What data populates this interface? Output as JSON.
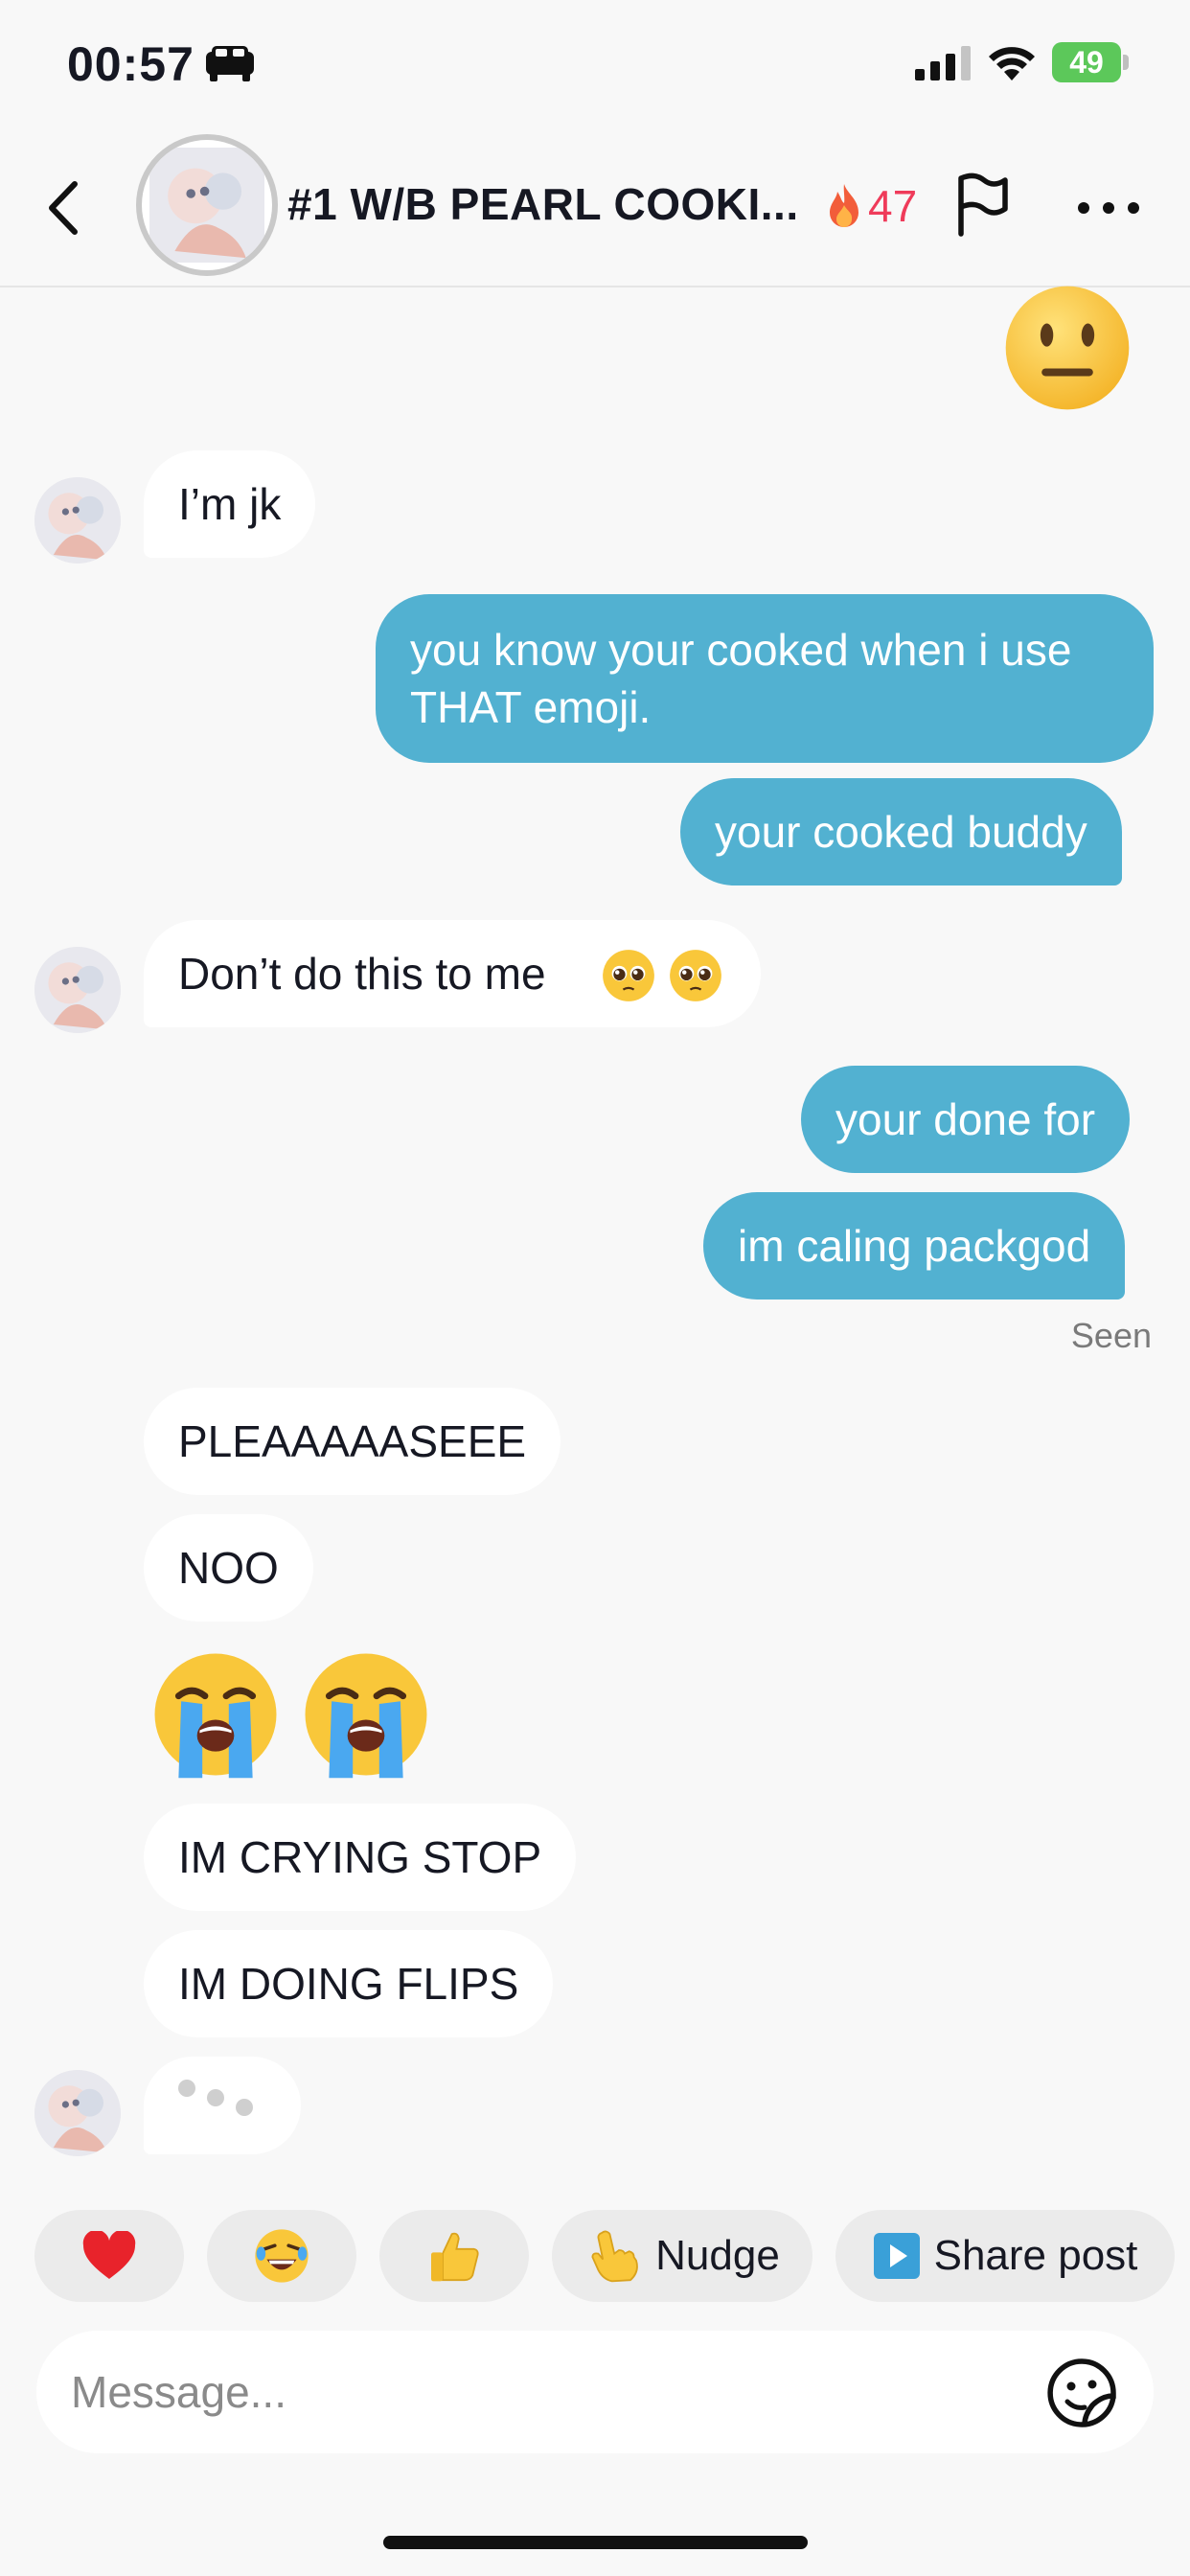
{
  "status_bar": {
    "time": "00:57",
    "battery": "49"
  },
  "header": {
    "title": "#1 W/B PEARL COOKI...",
    "streak_count": "47"
  },
  "messages": [
    {
      "from": "me",
      "type": "emoji",
      "emoji": "neutral-face"
    },
    {
      "from": "them",
      "type": "text",
      "text": "I’m jk"
    },
    {
      "from": "me",
      "type": "text",
      "text": "you know your cooked when i use THAT emoji."
    },
    {
      "from": "me",
      "type": "text",
      "text": "your cooked buddy"
    },
    {
      "from": "them",
      "type": "text",
      "text": "Don’t do this to me"
    },
    {
      "from": "me",
      "type": "text",
      "text": "your done for"
    },
    {
      "from": "me",
      "type": "text",
      "text": "im caling packgod"
    },
    {
      "from": "them",
      "type": "text",
      "text": "PLEAAAAASEEE"
    },
    {
      "from": "them",
      "type": "text",
      "text": "NOO"
    },
    {
      "from": "them",
      "type": "emoji",
      "emoji": "loudly-crying-face x2"
    },
    {
      "from": "them",
      "type": "text",
      "text": "IM CRYING STOP"
    },
    {
      "from": "them",
      "type": "text",
      "text": "IM DOING FLIPS"
    }
  ],
  "seen_label": "Seen",
  "quick_replies": {
    "heart": "heart-emoji",
    "laugh": "laughing-emoji",
    "thumbs": "thumbs-up-emoji",
    "nudge": "Nudge",
    "share": "Share post"
  },
  "composer": {
    "placeholder": "Message..."
  },
  "colors": {
    "outgoing": "#52b1d1",
    "incoming": "#ffffff",
    "streak": "#ef3b5a",
    "background": "#f8f8f8"
  }
}
